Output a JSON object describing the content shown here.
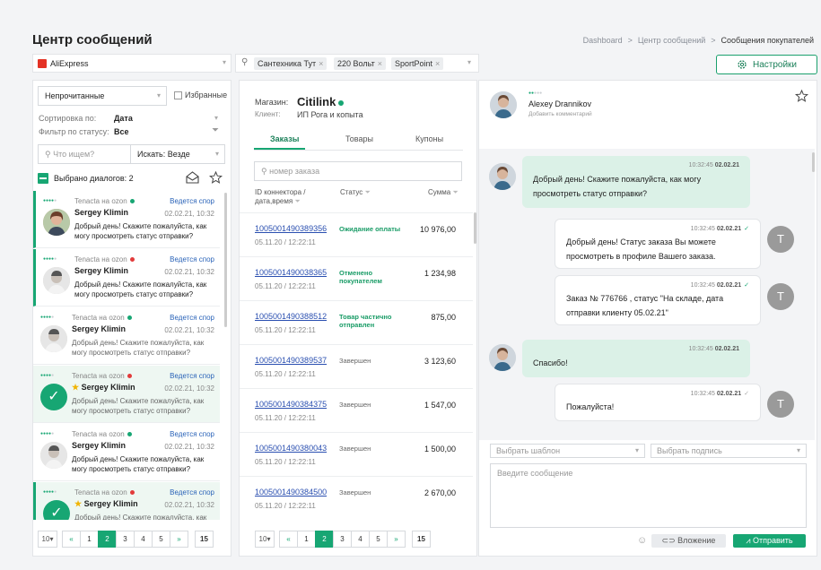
{
  "page": {
    "title": "Центр сообщений"
  },
  "breadcrumb": [
    "Dashboard",
    "Центр сообщений",
    "Сообщения покупателей"
  ],
  "marketplace": {
    "value": "AliExpress"
  },
  "shop_filter": {
    "chips": [
      "Сантехника Тут",
      "220 Вольт",
      "SportPoint"
    ]
  },
  "settings_label": "Настройки",
  "left": {
    "filter_value": "Непрочитанные",
    "favorites_label": "Избранные",
    "sort_label": "Сортировка по:",
    "sort_value": "Дата",
    "status_label": "Фильтр по статусу:",
    "status_value": "Все",
    "search_placeholder": "Что ищем?",
    "search_in_label": "Искать:",
    "search_in_value": "Везде",
    "selected_label": "Выбрано диалогов: 2",
    "conversations": [
      {
        "shop": "Tenacta на ozon",
        "status": "green",
        "dispute": "Ведется спор",
        "name": "Sergey Klimin",
        "date": "02.02.21, 10:32",
        "message": "Добрый день! Скажите пожалуйста, как могу просмотреть статус отправки?"
      },
      {
        "shop": "Tenacta на ozon",
        "status": "red",
        "dispute": "Ведется спор",
        "name": "Sergey Klimin",
        "date": "02.02.21, 10:32",
        "message": "Добрый день! Скажите пожалуйста, как могу просмотреть статус отправки?"
      },
      {
        "shop": "Tenacta на ozon",
        "status": "green",
        "dispute": "Ведется спор",
        "name": "Sergey Klimin",
        "date": "02.02.21, 10:32",
        "message": "Добрый день! Скажите пожалуйста, как могу просмотреть статус отправки?"
      },
      {
        "shop": "Tenacta на ozon",
        "status": "red",
        "dispute": "Ведется спор",
        "name": "Sergey Klimin",
        "date": "02.02.21, 10:32",
        "message": "Добрый день! Скажите пожалуйста, как могу просмотреть статус отправки?"
      },
      {
        "shop": "Tenacta на ozon",
        "status": "green",
        "dispute": "Ведется спор",
        "name": "Sergey Klimin",
        "date": "02.02.21, 10:32",
        "message": "Добрый день! Скажите пожалуйста, как могу просмотреть статус отправки?"
      },
      {
        "shop": "Tenacta на ozon",
        "status": "red",
        "dispute": "Ведется спор",
        "name": "Sergey Klimin",
        "date": "02.02.21, 10:32",
        "message": "Добрый день! Скажите пожалуйста, как могу просмотреть статус отправки?"
      }
    ],
    "pagination": {
      "per_page": "10",
      "prev": "«",
      "pages": [
        "1",
        "2",
        "3",
        "4",
        "5"
      ],
      "next": "»",
      "last": "15"
    }
  },
  "middle": {
    "shop_label": "Магазин:",
    "shop_name": "Citilink",
    "client_label": "Клиент:",
    "client_name": "ИП Рога и копыта",
    "tabs": [
      "Заказы",
      "Товары",
      "Купоны"
    ],
    "search_placeholder": "номер заказа",
    "col_id": "ID коннектора / дата,время",
    "col_status": "Статус",
    "col_sum": "Сумма",
    "orders": [
      {
        "id": "1005001490389356",
        "date": "05.11.20 / 12:22:11",
        "status": "Ожидание оплаты",
        "status_kind": "green",
        "sum": "10 976,00"
      },
      {
        "id": "1005001490038365",
        "date": "05.11.20 / 12:22:11",
        "status": "Отменено покупателем",
        "status_kind": "green",
        "sum": "1 234,98"
      },
      {
        "id": "1005001490388512",
        "date": "05.11.20 / 12:22:11",
        "status": "Товар частично отправлен",
        "status_kind": "green",
        "sum": "875,00"
      },
      {
        "id": "1005001490389537",
        "date": "05.11.20 / 12:22:11",
        "status": "Завершен",
        "status_kind": "gray",
        "sum": "3 123,60"
      },
      {
        "id": "1005001490384375",
        "date": "05.11.20 / 12:22:11",
        "status": "Завершен",
        "status_kind": "gray",
        "sum": "1 547,00"
      },
      {
        "id": "1005001490380043",
        "date": "05.11.20 / 12:22:11",
        "status": "Завершен",
        "status_kind": "gray",
        "sum": "1 500,00"
      },
      {
        "id": "1005001490384500",
        "date": "05.11.20 / 12:22:11",
        "status": "Завершен",
        "status_kind": "gray",
        "sum": "2 670,00"
      }
    ],
    "pagination": {
      "per_page": "10",
      "prev": "«",
      "pages": [
        "1",
        "2",
        "3",
        "4",
        "5"
      ],
      "next": "»",
      "last": "15"
    }
  },
  "chat": {
    "contact_name": "Alexey Drannikov",
    "contact_note": "Добавить комментарий",
    "avatar_letter": "T",
    "messages": [
      {
        "dir": "in",
        "time": "10:32:45",
        "date": "02.02.21",
        "text": "Добрый день! Скажите пожалуйста, как могу просмотреть статус отправки?"
      },
      {
        "dir": "out",
        "time": "10:32:45",
        "date": "02.02.21",
        "tick": "✓",
        "text": "Добрый день! Статус заказа Вы можете просмотреть в профиле Вашего заказа."
      },
      {
        "dir": "out",
        "time": "10:32:45",
        "date": "02.02.21",
        "tick": "✓",
        "text": "Заказ № 776766 , статус \"На складе, дата отправки клиенту 05.02.21\""
      },
      {
        "dir": "in",
        "time": "10:32:45",
        "date": "02.02.21",
        "text": "Спасибо!"
      },
      {
        "dir": "out",
        "time": "10:32:45",
        "date": "02.02.21",
        "tick": "✓",
        "text": "Пожалуйста!"
      }
    ],
    "template_placeholder": "Выбрать шаблон",
    "signature_placeholder": "Выбрать подпись",
    "input_placeholder": "Введите сообщение",
    "attach_label": "Вложение",
    "send_label": "Отправить"
  }
}
